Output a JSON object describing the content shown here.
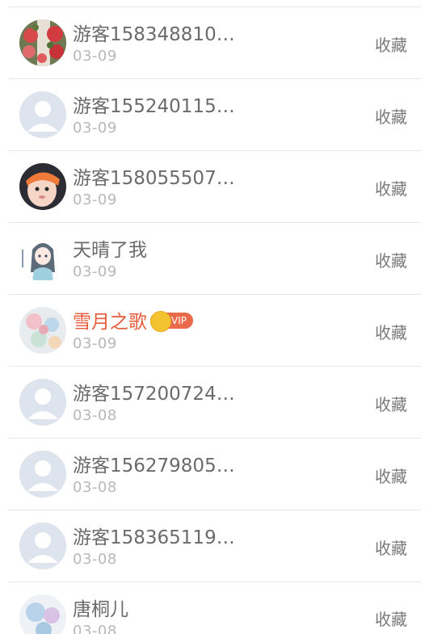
{
  "collectors": [
    {
      "name": "游客158348810…",
      "date": "03-09",
      "action": "收藏",
      "avatar": "roses-photo-avatar",
      "vip": false
    },
    {
      "name": "游客155240115…",
      "date": "03-09",
      "action": "收藏",
      "avatar": "default-user-avatar",
      "vip": false
    },
    {
      "name": "游客158055507…",
      "date": "03-09",
      "action": "收藏",
      "avatar": "baby-photo-avatar",
      "vip": false
    },
    {
      "name": "天晴了我",
      "date": "03-09",
      "action": "收藏",
      "avatar": "anime-girl-avatar",
      "vip": false
    },
    {
      "name": "雪月之歌",
      "date": "03-09",
      "action": "收藏",
      "avatar": "floral-art-avatar",
      "vip": true,
      "vip_label": "VIP"
    },
    {
      "name": "游客157200724…",
      "date": "03-08",
      "action": "收藏",
      "avatar": "default-user-avatar",
      "vip": false
    },
    {
      "name": "游客156279805…",
      "date": "03-08",
      "action": "收藏",
      "avatar": "default-user-avatar",
      "vip": false
    },
    {
      "name": "游客158365119…",
      "date": "03-08",
      "action": "收藏",
      "avatar": "default-user-avatar",
      "vip": false
    },
    {
      "name": "唐桐儿",
      "date": "03-08",
      "action": "收藏",
      "avatar": "anime-art-avatar",
      "vip": false
    }
  ],
  "colors": {
    "name_text": "#6b6b6b",
    "vip_name_text": "#e75b3b",
    "date_text": "#b8b8b8",
    "action_text": "#7a7a7a",
    "divider": "#e6e6e6",
    "vip_badge": "#e96a4b",
    "default_avatar_bg": "#dde4ee"
  }
}
